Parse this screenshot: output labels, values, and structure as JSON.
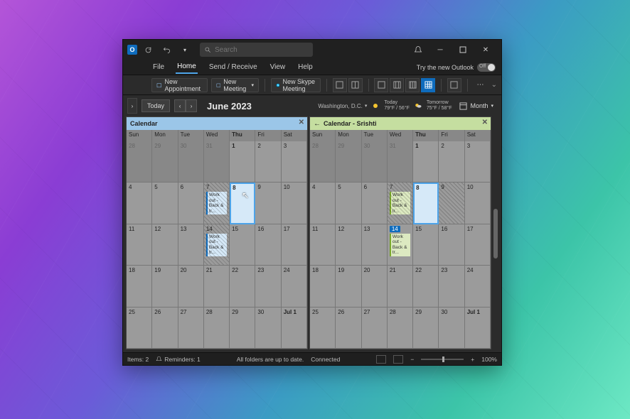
{
  "titlebar": {
    "search_placeholder": "Search"
  },
  "menubar": {
    "items": [
      "File",
      "Home",
      "Send / Receive",
      "View",
      "Help"
    ],
    "active_index": 1,
    "try_new": "Try the new Outlook",
    "toggle_label": "Off"
  },
  "ribbon": {
    "new_appointment": "New Appointment",
    "new_meeting": "New Meeting",
    "new_skype": "New Skype Meeting"
  },
  "toolbar": {
    "today": "Today",
    "month_title": "June 2023",
    "location": "Washington, D.C.",
    "weather": {
      "today_label": "Today",
      "today_temps": "79°F / 56°F",
      "tomorrow_label": "Tomorrow",
      "tomorrow_temps": "75°F / 58°F"
    },
    "view": "Month"
  },
  "dow": [
    "Sun",
    "Mon",
    "Tue",
    "Wed",
    "Thu",
    "Fri",
    "Sat"
  ],
  "calendars": [
    {
      "title": "Calendar",
      "color": "blue",
      "has_back": false,
      "weeks": [
        [
          {
            "n": "28",
            "o": true
          },
          {
            "n": "29",
            "o": true
          },
          {
            "n": "30",
            "o": true
          },
          {
            "n": "31",
            "o": true
          },
          {
            "n": "1",
            "b": true
          },
          {
            "n": "2"
          },
          {
            "n": "3"
          }
        ],
        [
          {
            "n": "4"
          },
          {
            "n": "5"
          },
          {
            "n": "6"
          },
          {
            "n": "7",
            "ev": {
              "t": "Work out - Back & tr...",
              "c": "blue"
            },
            "hatch": true
          },
          {
            "n": "8",
            "today": true,
            "b": true
          },
          {
            "n": "9"
          },
          {
            "n": "10"
          }
        ],
        [
          {
            "n": "11"
          },
          {
            "n": "12"
          },
          {
            "n": "13"
          },
          {
            "n": "14",
            "ev": {
              "t": "Work out - Back & tr...",
              "c": "blue"
            },
            "hatch": true
          },
          {
            "n": "15"
          },
          {
            "n": "16"
          },
          {
            "n": "17"
          }
        ],
        [
          {
            "n": "18"
          },
          {
            "n": "19"
          },
          {
            "n": "20"
          },
          {
            "n": "21"
          },
          {
            "n": "22"
          },
          {
            "n": "23"
          },
          {
            "n": "24"
          }
        ],
        [
          {
            "n": "25"
          },
          {
            "n": "26"
          },
          {
            "n": "27"
          },
          {
            "n": "28"
          },
          {
            "n": "29"
          },
          {
            "n": "30"
          },
          {
            "n": "Jul 1",
            "b": true
          }
        ]
      ]
    },
    {
      "title": "Calendar - Srishti",
      "color": "green",
      "has_back": true,
      "weeks": [
        [
          {
            "n": "28",
            "o": true
          },
          {
            "n": "29",
            "o": true
          },
          {
            "n": "30",
            "o": true
          },
          {
            "n": "31",
            "o": true
          },
          {
            "n": "1",
            "b": true
          },
          {
            "n": "2"
          },
          {
            "n": "3"
          }
        ],
        [
          {
            "n": "4"
          },
          {
            "n": "5"
          },
          {
            "n": "6"
          },
          {
            "n": "7",
            "ev": {
              "t": "Work out - Back & tr...",
              "c": "green"
            },
            "hatch": true
          },
          {
            "n": "8",
            "today": true,
            "b": true
          },
          {
            "n": "9",
            "hatch": true
          },
          {
            "n": "10"
          }
        ],
        [
          {
            "n": "11"
          },
          {
            "n": "12"
          },
          {
            "n": "13"
          },
          {
            "n": "14",
            "sel": true,
            "ev": {
              "t": "Work out - Back & tr...",
              "c": "green"
            }
          },
          {
            "n": "15"
          },
          {
            "n": "16"
          },
          {
            "n": "17"
          }
        ],
        [
          {
            "n": "18"
          },
          {
            "n": "19"
          },
          {
            "n": "20"
          },
          {
            "n": "21"
          },
          {
            "n": "22"
          },
          {
            "n": "23"
          },
          {
            "n": "24"
          }
        ],
        [
          {
            "n": "25"
          },
          {
            "n": "26"
          },
          {
            "n": "27"
          },
          {
            "n": "28"
          },
          {
            "n": "29"
          },
          {
            "n": "30"
          },
          {
            "n": "Jul 1",
            "b": true
          }
        ]
      ]
    }
  ],
  "statusbar": {
    "items": "Items: 2",
    "reminders": "Reminders: 1",
    "folders": "All folders are up to date.",
    "connected": "Connected",
    "zoom": "100%"
  }
}
